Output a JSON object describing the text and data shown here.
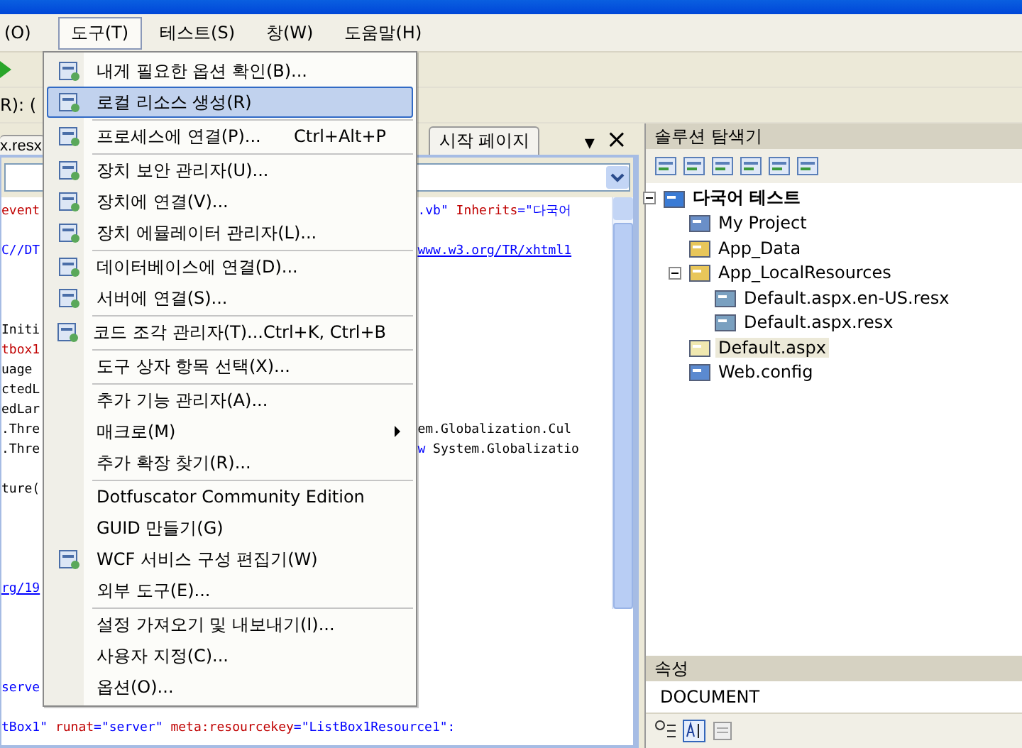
{
  "menubar": [
    {
      "label": "(O)",
      "selected": false
    },
    {
      "label": "도구(T)",
      "selected": true
    },
    {
      "label": "테스트(S)",
      "selected": false
    },
    {
      "label": "창(W)",
      "selected": false
    },
    {
      "label": "도움말(H)",
      "selected": false
    }
  ],
  "toolbar": {
    "field_text": "R): ("
  },
  "tabs": [
    {
      "label": "x.resx",
      "selected": false
    },
    {
      "label": "시작 페이지",
      "selected": false
    }
  ],
  "tab_controls": {
    "dropdown": "▾",
    "close": "×"
  },
  "code_lines": [
    {
      "kind": "split",
      "left": [
        {
          "text": "event",
          "kind": "attr"
        }
      ],
      "right": [
        {
          "text": ".vb\" ",
          "kind": "value"
        },
        {
          "text": "Inherits",
          "kind": "attr"
        },
        {
          "text": "=\"다국어",
          "kind": "value"
        }
      ]
    },
    {
      "kind": "blank"
    },
    {
      "kind": "split",
      "left": [
        {
          "text": "C//DT",
          "kind": "value"
        }
      ],
      "right": [
        {
          "text": "www.w3.org/TR/xhtml1",
          "kind": "link"
        }
      ]
    },
    {
      "kind": "blank"
    },
    {
      "kind": "blank"
    },
    {
      "kind": "blank"
    },
    {
      "kind": "split",
      "left": [
        {
          "text": "Initi",
          "kind": "text"
        }
      ]
    },
    {
      "kind": "split",
      "left": [
        {
          "text": "tbox1",
          "kind": "attr"
        }
      ]
    },
    {
      "kind": "split",
      "left": [
        {
          "text": "uage",
          "kind": "text"
        }
      ]
    },
    {
      "kind": "split",
      "left": [
        {
          "text": "ctedL",
          "kind": "text"
        }
      ]
    },
    {
      "kind": "split",
      "left": [
        {
          "text": "edLar",
          "kind": "text"
        }
      ]
    },
    {
      "kind": "split",
      "left": [
        {
          "text": ".Thre",
          "kind": "text"
        }
      ],
      "right": [
        {
          "text": "em.Globalization.Cul",
          "kind": "text"
        }
      ]
    },
    {
      "kind": "split",
      "left": [
        {
          "text": ".Thre",
          "kind": "text"
        }
      ],
      "right": [
        {
          "text": "w",
          "kind": "value"
        },
        {
          "text": " System.Globalizatio",
          "kind": "text"
        }
      ]
    },
    {
      "kind": "blank"
    },
    {
      "kind": "split",
      "left": [
        {
          "text": "ture(",
          "kind": "text"
        }
      ]
    },
    {
      "kind": "blank"
    },
    {
      "kind": "blank"
    },
    {
      "kind": "blank"
    },
    {
      "kind": "blank"
    },
    {
      "kind": "split",
      "left": [
        {
          "text": "rg/19",
          "kind": "link"
        }
      ]
    },
    {
      "kind": "blank"
    },
    {
      "kind": "blank"
    },
    {
      "kind": "blank"
    },
    {
      "kind": "blank"
    },
    {
      "kind": "split",
      "left": [
        {
          "text": "serve",
          "kind": "value"
        }
      ]
    },
    {
      "kind": "blank"
    },
    {
      "kind": "full",
      "full": [
        {
          "text": "tBox1\" ",
          "kind": "value"
        },
        {
          "text": "runat",
          "kind": "attr"
        },
        {
          "text": "=\"server\" ",
          "kind": "value"
        },
        {
          "text": "meta:resourcekey",
          "kind": "attr"
        },
        {
          "text": "=\"ListBox1Resource1\":",
          "kind": "value"
        }
      ]
    }
  ],
  "menu": {
    "groups": [
      [
        {
          "label": "내게 필요한 옵션 확인(B)...",
          "icon": true,
          "selected": false
        },
        {
          "label": "로컬 리소스 생성(R)",
          "icon": true,
          "selected": true
        }
      ],
      [
        {
          "label": "프로세스에 연결(P)...",
          "shortcut": "Ctrl+Alt+P",
          "icon": true,
          "selected": false
        }
      ],
      [
        {
          "label": "장치 보안 관리자(U)...",
          "icon": true,
          "selected": false
        },
        {
          "label": "장치에 연결(V)...",
          "icon": true,
          "selected": false
        },
        {
          "label": "장치 에뮬레이터 관리자(L)...",
          "icon": true,
          "selected": false
        }
      ],
      [
        {
          "label": "데이터베이스에 연결(D)...",
          "icon": true,
          "selected": false
        },
        {
          "label": "서버에 연결(S)...",
          "icon": true,
          "selected": false
        }
      ],
      [
        {
          "label": "코드 조각 관리자(T)...",
          "shortcut": "Ctrl+K, Ctrl+B",
          "icon": true,
          "selected": false
        }
      ],
      [
        {
          "label": "도구 상자 항목 선택(X)...",
          "icon": false,
          "selected": false
        }
      ],
      [
        {
          "label": "추가 기능 관리자(A)...",
          "icon": false,
          "selected": false
        },
        {
          "label": "매크로(M)",
          "icon": false,
          "submenu": true,
          "selected": false
        },
        {
          "label": "추가 확장 찾기(R)...",
          "icon": false,
          "selected": false
        }
      ],
      [
        {
          "label": "Dotfuscator Community Edition",
          "icon": false,
          "selected": false
        },
        {
          "label": "GUID 만들기(G)",
          "icon": false,
          "selected": false
        },
        {
          "label": "WCF 서비스 구성 편집기(W)",
          "icon": true,
          "selected": false
        },
        {
          "label": "외부 도구(E)...",
          "icon": false,
          "selected": false
        }
      ],
      [
        {
          "label": "설정 가져오기 및 내보내기(I)...",
          "icon": false,
          "selected": false
        },
        {
          "label": "사용자 지정(C)...",
          "icon": false,
          "selected": false
        },
        {
          "label": "옵션(O)...",
          "icon": false,
          "selected": false
        }
      ]
    ]
  },
  "solution_explorer": {
    "title": "솔루션 탐색기",
    "tree": [
      {
        "label": "다국어 테스트",
        "kind": "solution",
        "selected": false,
        "expanded": true,
        "children": [
          {
            "label": "My Project",
            "kind": "project",
            "selected": false
          },
          {
            "label": "App_Data",
            "kind": "folder",
            "selected": false
          },
          {
            "label": "App_LocalResources",
            "kind": "folder",
            "selected": false,
            "expanded": true,
            "children": [
              {
                "label": "Default.aspx.en-US.resx",
                "kind": "resource",
                "selected": false
              },
              {
                "label": "Default.aspx.resx",
                "kind": "resource",
                "selected": false
              }
            ]
          },
          {
            "label": "Default.aspx",
            "kind": "page",
            "selected": true
          },
          {
            "label": "Web.config",
            "kind": "config",
            "selected": false
          }
        ]
      }
    ]
  },
  "properties": {
    "title": "속성",
    "object": "DOCUMENT"
  }
}
